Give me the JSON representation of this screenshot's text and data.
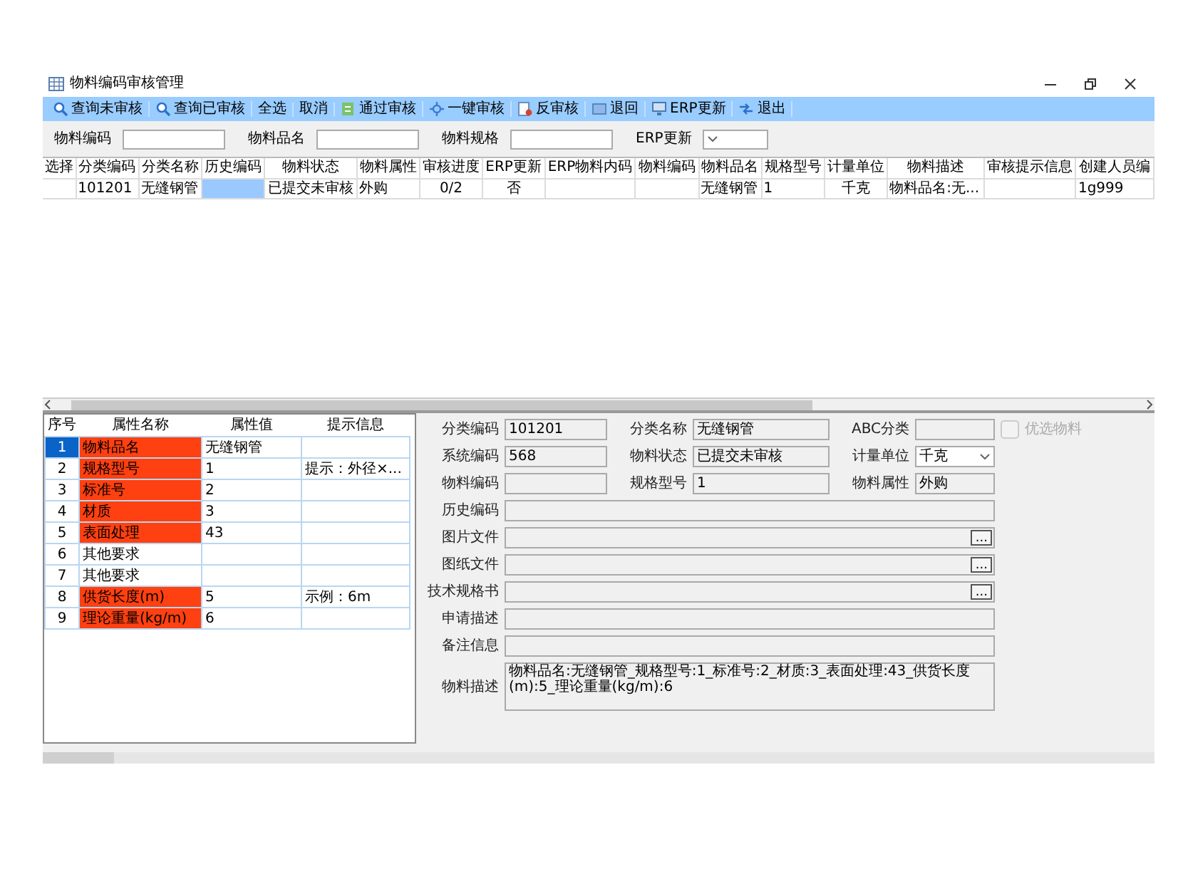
{
  "window": {
    "title": "物料编码审核管理"
  },
  "toolbar": [
    {
      "label": "查询未审核"
    },
    {
      "label": "查询已审核"
    },
    {
      "label": "全选"
    },
    {
      "label": "取消"
    },
    {
      "label": "通过审核"
    },
    {
      "label": "一键审核"
    },
    {
      "label": "反审核"
    },
    {
      "label": "退回"
    },
    {
      "label": "ERP更新"
    },
    {
      "label": "退出"
    }
  ],
  "filters": [
    {
      "label": "物料编码",
      "kind": "text"
    },
    {
      "label": "物料品名",
      "kind": "text"
    },
    {
      "label": "物料规格",
      "kind": "text"
    },
    {
      "label": "ERP更新",
      "kind": "select"
    }
  ],
  "table": {
    "columns": [
      "选择",
      "分类编码",
      "分类名称",
      "历史编码",
      "物料状态",
      "物料属性",
      "审核进度",
      "ERP更新",
      "ERP物料内码",
      "物料编码",
      "物料品名",
      "规格型号",
      "计量单位",
      "物料描述",
      "审核提示信息",
      "创建人员编"
    ],
    "rows": [
      {
        "cells": [
          {
            "selected": false
          },
          {
            "text": "101201",
            "selected": false
          },
          {
            "text": "无缝钢管",
            "selected": false
          },
          {
            "selected": true
          },
          {
            "text": "已提交未审核",
            "selected": false
          },
          {
            "text": "外购",
            "selected": false
          },
          {
            "text": "0/2",
            "selected": false
          },
          {
            "text": "否",
            "selected": false
          },
          {
            "selected": false
          },
          {
            "selected": false
          },
          {
            "text": "无缝钢管",
            "selected": false
          },
          {
            "text": "1",
            "selected": false
          },
          {
            "text": "千克",
            "selected": false
          },
          {
            "text": "物料品名:无...",
            "selected": false
          },
          {
            "selected": false
          },
          {
            "text": "1g999",
            "selected": false
          }
        ]
      }
    ]
  },
  "attributes": {
    "columns": [
      "序号",
      "属性名称",
      "属性值",
      "提示信息"
    ],
    "rows": [
      {
        "no": "1",
        "name": "物料品名",
        "value": "无缝钢管",
        "required": true,
        "selected": true
      },
      {
        "no": "2",
        "name": "规格型号",
        "value": "1",
        "hint": "提示：外径×...",
        "required": true,
        "selected": false
      },
      {
        "no": "3",
        "name": "标准号",
        "value": "2",
        "required": true,
        "selected": false
      },
      {
        "no": "4",
        "name": "材质",
        "value": "3",
        "required": true,
        "selected": false
      },
      {
        "no": "5",
        "name": "表面处理",
        "value": "43",
        "required": true,
        "selected": false
      },
      {
        "no": "6",
        "name": "其他要求",
        "required": false,
        "selected": false
      },
      {
        "no": "7",
        "name": "其他要求",
        "required": false,
        "selected": false
      },
      {
        "no": "8",
        "name": "供货长度(m)",
        "value": "5",
        "hint": "示例：6m",
        "required": true,
        "selected": false
      },
      {
        "no": "9",
        "name": "理论重量(kg/m)",
        "value": "6",
        "required": true,
        "selected": false
      }
    ]
  },
  "form": {
    "grid": [
      [
        {
          "label": "分类编码",
          "value": "101201",
          "kind": "text"
        },
        {
          "label": "分类名称",
          "value": "无缝钢管",
          "kind": "text"
        },
        {
          "label": "ABC分类",
          "kind": "text"
        }
      ],
      [
        {
          "label": "系统编码",
          "value": "568",
          "kind": "text"
        },
        {
          "label": "物料状态",
          "value": "已提交未审核",
          "kind": "text"
        },
        {
          "label": "计量单位",
          "value": "千克",
          "kind": "select"
        }
      ],
      [
        {
          "label": "物料编码",
          "kind": "text"
        },
        {
          "label": "规格型号",
          "value": "1",
          "kind": "text"
        },
        {
          "label": "物料属性",
          "value": "外购",
          "kind": "text"
        }
      ]
    ],
    "checkbox": {
      "label": "优选物料",
      "checked": false,
      "disabled": true
    },
    "wide_fields": [
      {
        "label": "历史编码",
        "kind": "text"
      },
      {
        "label": "图片文件",
        "kind": "browse",
        "button": "..."
      },
      {
        "label": "图纸文件",
        "kind": "browse",
        "button": "..."
      },
      {
        "label": "技术规格书",
        "kind": "browse",
        "button": "..."
      },
      {
        "label": "申请描述",
        "kind": "text"
      },
      {
        "label": "备注信息",
        "kind": "text"
      },
      {
        "label": "物料描述",
        "value": "物料品名:无缝钢管_规格型号:1_标准号:2_材质:3_表面处理:43_供货长度(m):5_理论重量(kg/m):6",
        "kind": "textarea"
      }
    ]
  }
}
